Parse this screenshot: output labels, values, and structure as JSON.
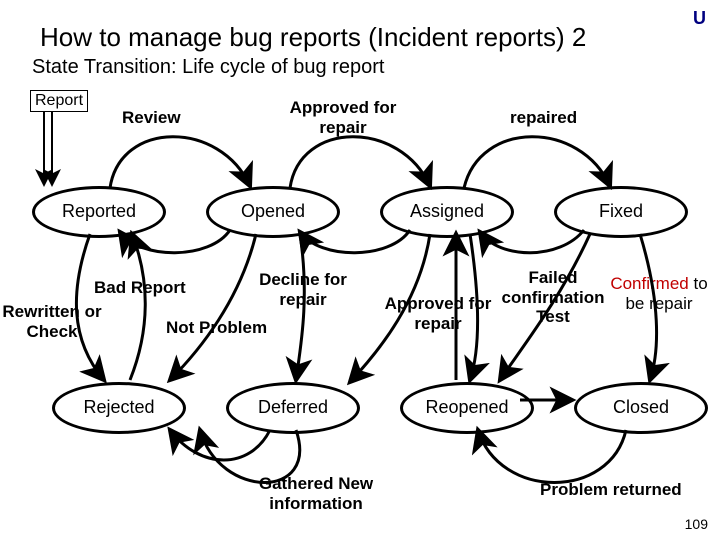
{
  "corner_letter": "U",
  "slide_number": "109",
  "title": "How to manage bug reports (Incident reports) 2",
  "subtitle": "State Transition: Life cycle of bug report",
  "report_box": "Report",
  "states_row1": [
    "Reported",
    "Opened",
    "Assigned",
    "Fixed"
  ],
  "states_row2": [
    "Rejected",
    "Deferred",
    "Reopened",
    "Closed"
  ],
  "transitions": {
    "review": "Review",
    "approved_for_repair_top": "Approved for\nrepair",
    "repaired": "repaired",
    "bad_report": "Bad Report",
    "decline_for_repair": "Decline for\nrepair",
    "approved_for_repair_mid": "Approved for\nrepair",
    "failed_confirmation_test": "Failed\nconfirmation\nTest",
    "confirmed_to_be_repair": "Confirmed to\nbe repair",
    "confirmed_word": "Confirmed",
    "rewritten_or_check": "Rewritten or\nCheck",
    "not_problem": "Not Problem",
    "gathered_new_info": "Gathered New\ninformation",
    "problem_returned": "Problem returned"
  }
}
